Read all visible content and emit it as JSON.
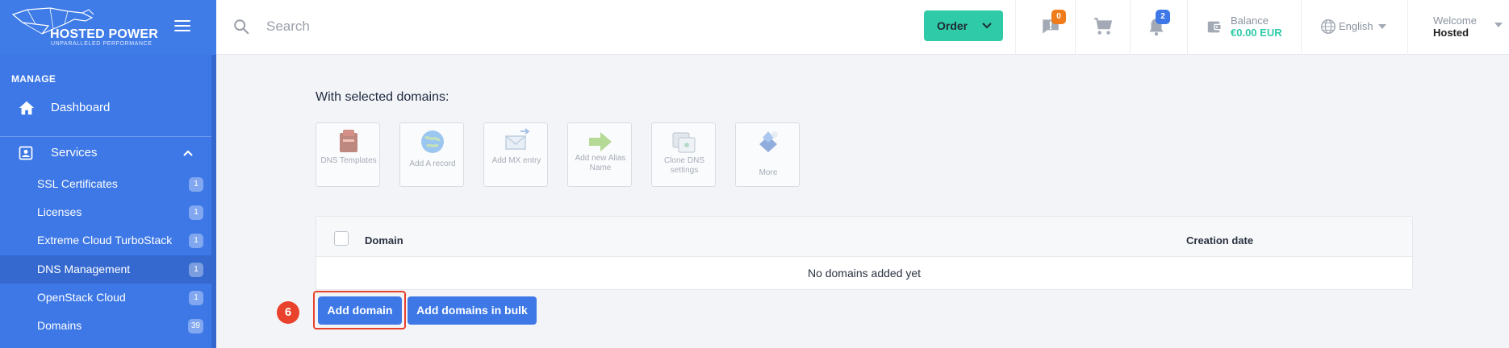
{
  "brand": {
    "name": "HOSTED POWER",
    "tagline": "UNPARALLELED PERFORMANCE"
  },
  "sidebar": {
    "section_label": "MANAGE",
    "dashboard_label": "Dashboard",
    "services_label": "Services",
    "items": [
      {
        "label": "SSL Certificates",
        "count": "1"
      },
      {
        "label": "Licenses",
        "count": "1"
      },
      {
        "label": "Extreme Cloud TurboStack",
        "count": "1"
      },
      {
        "label": "DNS Management",
        "count": "1"
      },
      {
        "label": "OpenStack Cloud",
        "count": "1"
      },
      {
        "label": "Domains",
        "count": "39"
      }
    ]
  },
  "topbar": {
    "search_placeholder": "Search",
    "order_label": "Order",
    "messages_count": "0",
    "notifications_count": "2",
    "balance_label": "Balance",
    "balance_value": "€0.00 EUR",
    "language": "English",
    "welcome_label": "Welcome",
    "user_name": "Hosted"
  },
  "main": {
    "title": "With selected domains:",
    "actions": [
      {
        "label": "DNS Templates",
        "icon": "dns-templates-icon"
      },
      {
        "label": "Add A record",
        "icon": "globe-icon"
      },
      {
        "label": "Add MX entry",
        "icon": "mail-icon"
      },
      {
        "label": "Add new Alias Name",
        "icon": "arrow-right-icon"
      },
      {
        "label": "Clone DNS settings",
        "icon": "clone-icon"
      },
      {
        "label": "More",
        "icon": "more-icon"
      }
    ],
    "table": {
      "headers": {
        "domain": "Domain",
        "creation_date": "Creation date"
      },
      "empty_text": "No domains added yet"
    },
    "step_number": "6",
    "add_domain_label": "Add domain",
    "add_bulk_label": "Add domains in bulk"
  },
  "colors": {
    "sidebar": "#3d78e6",
    "accent_teal": "#2fcaa8",
    "highlight_red": "#e8412c",
    "badge_orange": "#f07b1a",
    "badge_blue": "#3d78e6"
  }
}
